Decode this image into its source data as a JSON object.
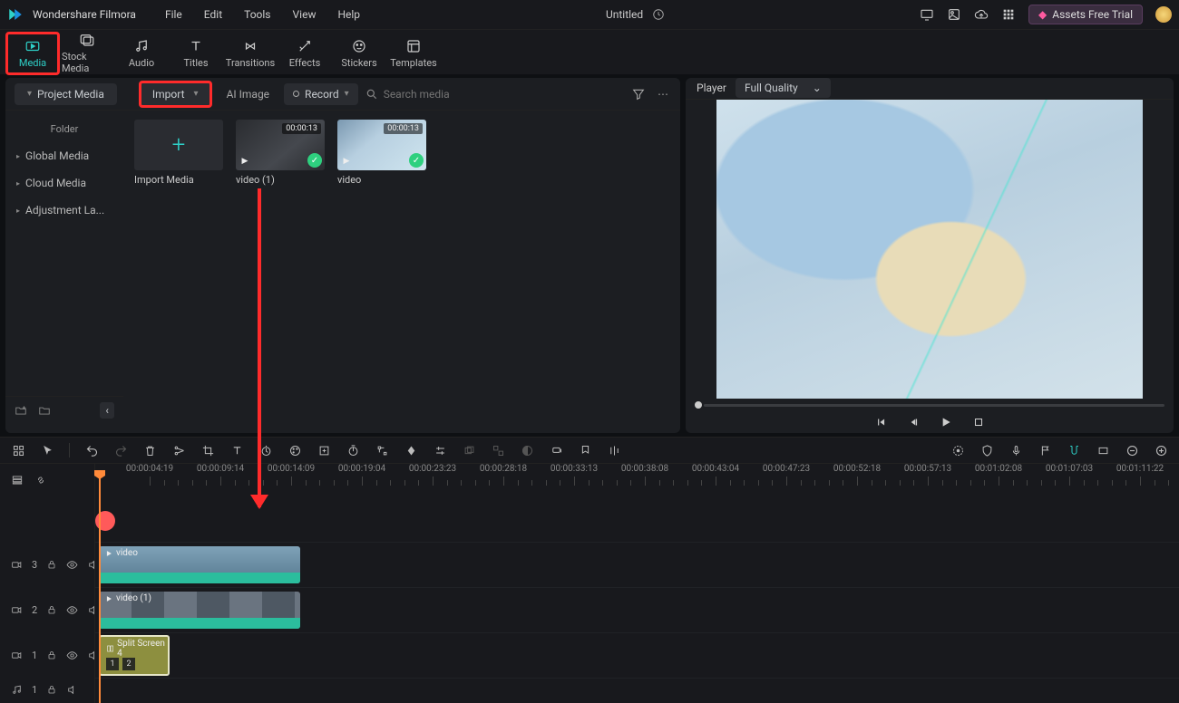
{
  "app": {
    "title": "Wondershare Filmora",
    "project_title": "Untitled",
    "assets_button": "Assets Free Trial"
  },
  "menu": {
    "file": "File",
    "edit": "Edit",
    "tools": "Tools",
    "view": "View",
    "help": "Help"
  },
  "tabs": {
    "media": "Media",
    "stock": "Stock Media",
    "audio": "Audio",
    "titles": "Titles",
    "transitions": "Transitions",
    "effects": "Effects",
    "stickers": "Stickers",
    "templates": "Templates"
  },
  "media_toolbar": {
    "project_media": "Project Media",
    "import": "Import",
    "ai_image": "AI Image",
    "record": "Record",
    "search_placeholder": "Search media"
  },
  "sidebar": {
    "folder_label": "Folder",
    "global": "Global Media",
    "cloud": "Cloud Media",
    "adjust": "Adjustment La..."
  },
  "media_items": {
    "import_label": "Import Media",
    "video1": {
      "label": "video (1)",
      "duration": "00:00:13"
    },
    "video2": {
      "label": "video",
      "duration": "00:00:13"
    }
  },
  "player": {
    "label": "Player",
    "quality": "Full Quality"
  },
  "timeline": {
    "ruler": [
      "00:00:04:19",
      "00:00:09:14",
      "00:00:14:09",
      "00:00:19:04",
      "00:00:23:23",
      "00:00:28:18",
      "00:00:33:13",
      "00:00:38:08",
      "00:00:43:04",
      "00:00:47:23",
      "00:00:52:18",
      "00:00:57:13",
      "00:01:02:08",
      "00:01:07:03",
      "00:01:11:22"
    ],
    "tracks": {
      "v3": {
        "label": "3",
        "clip_label": "video"
      },
      "v2": {
        "label": "2",
        "clip_label": "video (1)"
      },
      "v1": {
        "label": "1",
        "clip_label": "Split Screen 4",
        "box1": "1",
        "box2": "2"
      },
      "a1": {
        "label": "1"
      }
    }
  }
}
